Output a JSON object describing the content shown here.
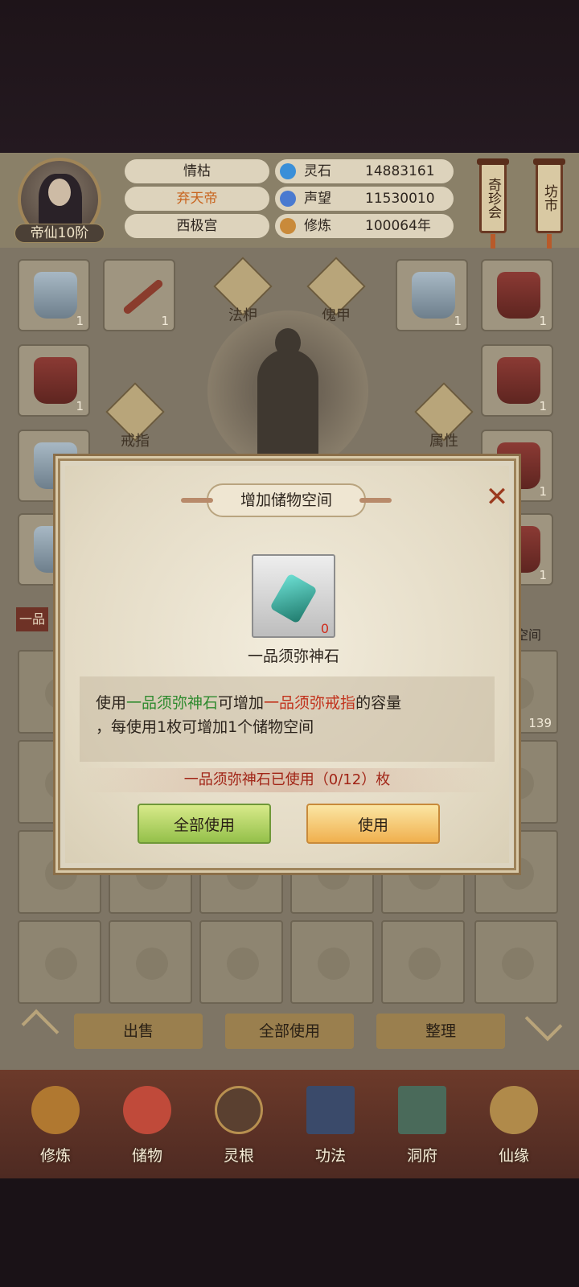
{
  "player": {
    "name": "情枯",
    "title": "弃天帝",
    "palace": "西极宫",
    "rank": "帝仙10阶"
  },
  "stats": [
    {
      "label": "灵石",
      "value": "14883161",
      "icon": "spirit-stone-icon",
      "color": "#3a8fd8"
    },
    {
      "label": "声望",
      "value": "11530010",
      "icon": "prestige-icon",
      "color": "#4a7ad0"
    },
    {
      "label": "修炼",
      "value": "100064年",
      "icon": "cultivation-icon",
      "color": "#c98a3a"
    }
  ],
  "side_buttons": {
    "treasure": "奇珍会",
    "market": "坊市"
  },
  "equipment": {
    "counts": [
      "1",
      "1",
      "1",
      "1",
      "1",
      "1",
      "1",
      "1"
    ],
    "center_labels": {
      "dharma": "法相",
      "puppet": "傀甲",
      "ring": "戒指",
      "attributes": "属性"
    }
  },
  "bag": {
    "tab_label": "一品",
    "space_label": "子空间",
    "item_count": "139"
  },
  "actions": {
    "sell": "出售",
    "use_all": "全部使用",
    "arrange": "整理"
  },
  "nav": [
    "修炼",
    "储物",
    "灵根",
    "功法",
    "洞府",
    "仙缘"
  ],
  "dialog": {
    "title": "增加储物空间",
    "item_name": "一品须弥神石",
    "item_qty": "0",
    "desc_part1": "使用",
    "desc_item": "一品须弥神石",
    "desc_part2": "可增加",
    "desc_target": "一品须弥戒指",
    "desc_part3": "的容量",
    "desc_line2": "，每使用1枚可增加1个储物空间",
    "usage": "一品须弥神石已使用（0/12）枚",
    "use_all_button": "全部使用",
    "use_button": "使用"
  }
}
